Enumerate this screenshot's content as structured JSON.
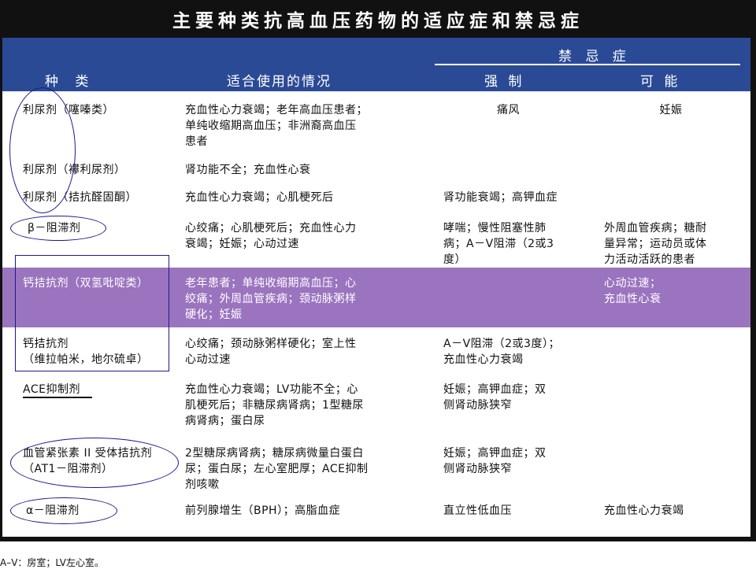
{
  "title": "主要种类抗高血压药物的适应症和禁忌症",
  "header": {
    "col_type": "种  类",
    "col_indication": "适合使用的情况",
    "contra_group": "禁 忌 症",
    "col_strong": "强   制",
    "col_possible": "可   能"
  },
  "rows": [
    {
      "type": "利尿剂（噻嗪类）",
      "indication": "充血性心力衰竭；老年高血压患者；\n单纯收缩期高血压；非洲裔高血压\n患者",
      "strong": "痛风",
      "possible": "妊娠"
    },
    {
      "type": "利尿剂（襻利尿剂）",
      "indication": "肾功能不全；充血性心衰",
      "strong": "",
      "possible": ""
    },
    {
      "type": "利尿剂（拮抗醛固酮）",
      "indication": "充血性心力衰竭；心肌梗死后",
      "strong": "肾功能衰竭；高钾血症",
      "possible": ""
    },
    {
      "type": "β－阻滞剂",
      "indication": "心绞痛；心肌梗死后；充血性心力\n衰竭；妊娠；心动过速",
      "strong": "哮喘；慢性阻塞性肺\n病；A－V阻滞（2或3\n度）",
      "possible": "外周血管疾病；糖耐\n量异常；运动员或体\n力活动活跃的患者"
    },
    {
      "type": "钙拮抗剂（双氢吡啶类）",
      "indication": "老年患者；单纯收缩期高血压；心\n绞痛；外周血管疾病；颈动脉粥样\n硬化；妊娠",
      "strong": "",
      "possible": "心动过速；\n充血性心衰"
    },
    {
      "type": "钙拮抗剂\n（维拉帕米，地尔硫卓）",
      "indication": "心绞痛；颈动脉粥样硬化；室上性\n心动过速",
      "strong": "A－V阻滞（2或3度）；\n充血性心力衰竭",
      "possible": ""
    },
    {
      "type": "ACE抑制剂",
      "indication": "充血性心力衰竭；LV功能不全；心\n肌梗死后；非糖尿病肾病；1型糖尿\n病肾病；蛋白尿",
      "strong": "妊娠；高钾血症；双\n侧肾动脉狭窄",
      "possible": ""
    },
    {
      "type": "血管紧张素 II 受体拮抗剂\n（AT1－阻滞剂）",
      "indication": "2型糖尿病肾病；糖尿病微量白蛋白\n尿；蛋白尿；左心室肥厚；ACE抑制\n剂咳嗽",
      "strong": "妊娠；高钾血症；双\n侧肾动脉狭窄",
      "possible": ""
    },
    {
      "type": "α－阻滞剂",
      "indication": "前列腺增生（BPH）；高脂血症",
      "strong": "直立性低血压",
      "possible": "充血性心力衰竭"
    }
  ],
  "footnote": "A–V：房室；LV左心室。",
  "colors": {
    "header_bg": "#2b4a96",
    "highlight_row": "#9b74bf",
    "frame": "#111111",
    "annotation": "#1a1a8c"
  }
}
